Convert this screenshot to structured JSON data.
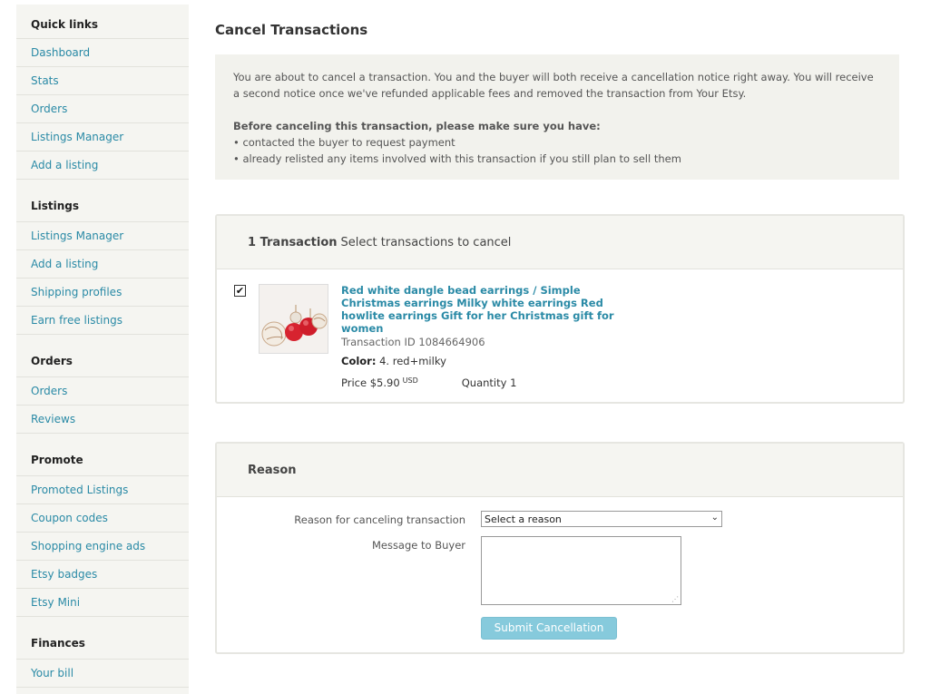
{
  "sidebar": {
    "sections": [
      {
        "title": "Quick links",
        "items": [
          "Dashboard",
          "Stats",
          "Orders",
          "Listings Manager",
          "Add a listing"
        ]
      },
      {
        "title": "Listings",
        "items": [
          "Listings Manager",
          "Add a listing",
          "Shipping profiles",
          "Earn free listings"
        ]
      },
      {
        "title": "Orders",
        "items": [
          "Orders",
          "Reviews"
        ]
      },
      {
        "title": "Promote",
        "items": [
          "Promoted Listings",
          "Coupon codes",
          "Shopping engine ads",
          "Etsy badges",
          "Etsy Mini"
        ]
      },
      {
        "title": "Finances",
        "items": [
          "Your bill"
        ]
      }
    ]
  },
  "page": {
    "title": "Cancel Transactions"
  },
  "notice": {
    "para1": "You are about to cancel a transaction. You and the buyer will both receive a cancellation notice right away. You will receive a second notice once we've refunded applicable fees and removed the transaction from Your Etsy.",
    "heading": "Before canceling this transaction, please make sure you have:",
    "bullet1": "• contacted the buyer to request payment",
    "bullet2": "• already relisted any items involved with this transaction if you still plan to sell them"
  },
  "transactions": {
    "count_label": "1 Transaction",
    "instruction": "Select transactions to cancel",
    "item": {
      "checked": true,
      "checkmark": "✔",
      "title": "Red white dangle bead earrings / Simple Christmas earrings Milky white earrings Red howlite earrings Gift for her Christmas gift for women",
      "transaction_id": "Transaction ID 1084664906",
      "color_label": "Color:",
      "color_value": "4. red+milky",
      "price_label": "Price $5.90",
      "currency": "USD",
      "quantity": "Quantity 1"
    }
  },
  "reason": {
    "heading": "Reason",
    "reason_label": "Reason for canceling transaction",
    "select_value": "Select a reason",
    "select_arrow": "⌄",
    "message_label": "Message to Buyer",
    "message_value": "",
    "submit_label": "Submit Cancellation"
  },
  "colors": {
    "link": "#2a8aa6",
    "panel_bg": "#f5f5f1",
    "submit_bg": "#86cadc"
  }
}
